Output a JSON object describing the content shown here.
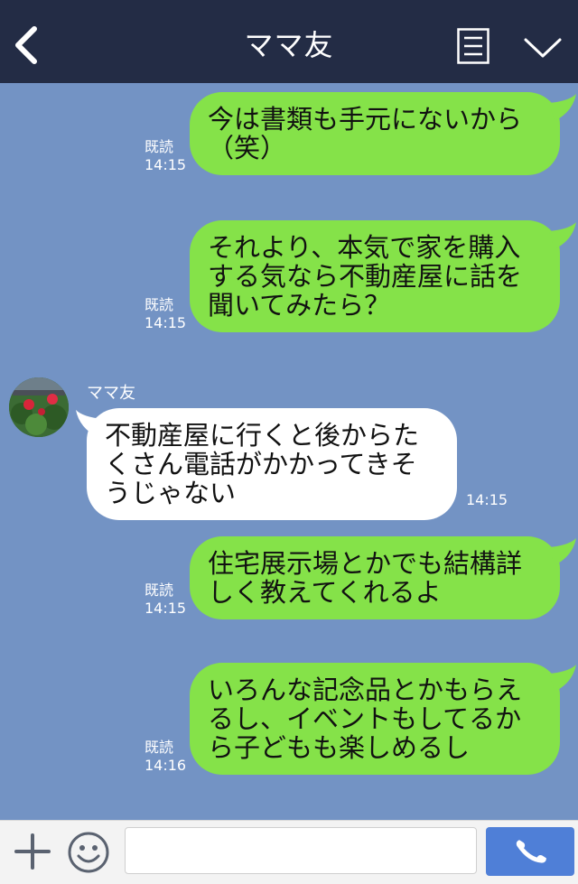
{
  "header": {
    "title": "ママ友",
    "back_icon": "chevron-left-icon",
    "menu_icon": "list-icon",
    "collapse_icon": "chevron-down-icon"
  },
  "messages": [
    {
      "direction": "out",
      "read_label": "既読",
      "time": "14:15",
      "lines": [
        "今は書類も手元にないから",
        "（笑）"
      ]
    },
    {
      "direction": "out",
      "read_label": "既読",
      "time": "14:15",
      "lines": [
        "それより、本気で家を購入",
        "する気なら不動産屋に話を",
        "聞いてみたら？"
      ]
    },
    {
      "direction": "in",
      "sender": "ママ友",
      "time": "14:15",
      "lines": [
        "不動産屋に行くと後からた",
        "くさん電話がかかってきそ",
        "うじゃない"
      ]
    },
    {
      "direction": "out",
      "read_label": "既読",
      "time": "14:15",
      "lines": [
        "住宅展示場とかでも結構詳",
        "しく教えてくれるよ"
      ]
    },
    {
      "direction": "out",
      "read_label": "既読",
      "time": "14:16",
      "lines": [
        "いろんな記念品とかもらえ",
        "るし、イベントもしてるか",
        "ら子どもも楽しめるし"
      ]
    }
  ],
  "input_bar": {
    "placeholder": "",
    "plus_icon": "plus-icon",
    "emoji_icon": "smiley-icon",
    "call_icon": "phone-icon"
  },
  "colors": {
    "header_bg": "#232c45",
    "chat_bg": "#7393c4",
    "outgoing_bubble": "#85e249",
    "incoming_bubble": "#ffffff",
    "call_button": "#4f7fd7"
  }
}
